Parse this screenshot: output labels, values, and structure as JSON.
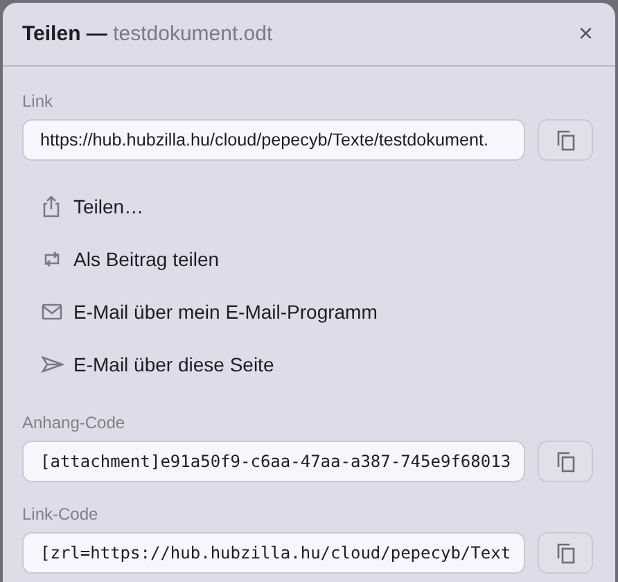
{
  "dialog": {
    "title": "Teilen —",
    "subtitle": "testdokument.odt",
    "close": "×"
  },
  "link": {
    "label": "Link",
    "value": "https://hub.hubzilla.hu/cloud/pepecyb/Texte/testdokument.",
    "kind": "text"
  },
  "actions": [
    {
      "label": "Teilen…",
      "kind": "share"
    },
    {
      "label": "Als Beitrag teilen",
      "kind": "repost"
    },
    {
      "label": "E-Mail über mein E-Mail-Programm",
      "kind": "mail"
    },
    {
      "label": "E-Mail über diese Seite",
      "kind": "send"
    }
  ],
  "codes": [
    {
      "label": "Anhang-Code",
      "value": "[attachment]e91a50f9-c6aa-47aa-a387-745e9f68013",
      "kind": "code"
    },
    {
      "label": "Link-Code",
      "value": "[zrl=https://hub.hubzilla.hu/cloud/pepecyb/Text",
      "kind": "code"
    }
  ]
}
